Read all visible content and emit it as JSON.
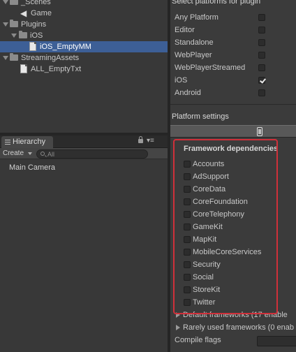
{
  "project": {
    "items": [
      {
        "label": "_Scenes",
        "type": "folder"
      },
      {
        "label": "Game",
        "type": "scene"
      },
      {
        "label": "Plugins",
        "type": "folder"
      },
      {
        "label": "iOS",
        "type": "folder"
      },
      {
        "label": "iOS_EmptyMM",
        "type": "file",
        "selected": true
      },
      {
        "label": "StreamingAssets",
        "type": "folder"
      },
      {
        "label": "ALL_EmptyTxt",
        "type": "file"
      }
    ]
  },
  "hierarchy": {
    "tab_label": "Hierarchy",
    "create_label": "Create",
    "search_placeholder": "All",
    "items": [
      "Main Camera"
    ]
  },
  "inspector": {
    "select_platforms_header": "Select platforms for plugin",
    "platforms": [
      {
        "label": "Any Platform",
        "checked": false
      },
      {
        "label": "Editor",
        "checked": false
      },
      {
        "label": "Standalone",
        "checked": false
      },
      {
        "label": "WebPlayer",
        "checked": false
      },
      {
        "label": "WebPlayerStreamed",
        "checked": false
      },
      {
        "label": "iOS",
        "checked": true
      },
      {
        "label": "Android",
        "checked": false
      }
    ],
    "platform_settings_header": "Platform settings",
    "framework_dependencies_title": "Framework dependencies",
    "frameworks": [
      {
        "label": "Accounts",
        "checked": false
      },
      {
        "label": "AdSupport",
        "checked": false
      },
      {
        "label": "CoreData",
        "checked": false
      },
      {
        "label": "CoreFoundation",
        "checked": false
      },
      {
        "label": "CoreTelephony",
        "checked": false
      },
      {
        "label": "GameKit",
        "checked": false
      },
      {
        "label": "MapKit",
        "checked": false
      },
      {
        "label": "MobileCoreServices",
        "checked": false
      },
      {
        "label": "Security",
        "checked": false
      },
      {
        "label": "Social",
        "checked": false
      },
      {
        "label": "StoreKit",
        "checked": false
      },
      {
        "label": "Twitter",
        "checked": false
      }
    ],
    "default_frameworks_label": "Default frameworks (17 enable",
    "rarely_used_label": "Rarely used frameworks (0 enab",
    "compile_flags_label": "Compile flags",
    "compile_flags_value": ""
  },
  "colors": {
    "selection": "#3d5f96",
    "highlight_box": "#d0303a"
  }
}
